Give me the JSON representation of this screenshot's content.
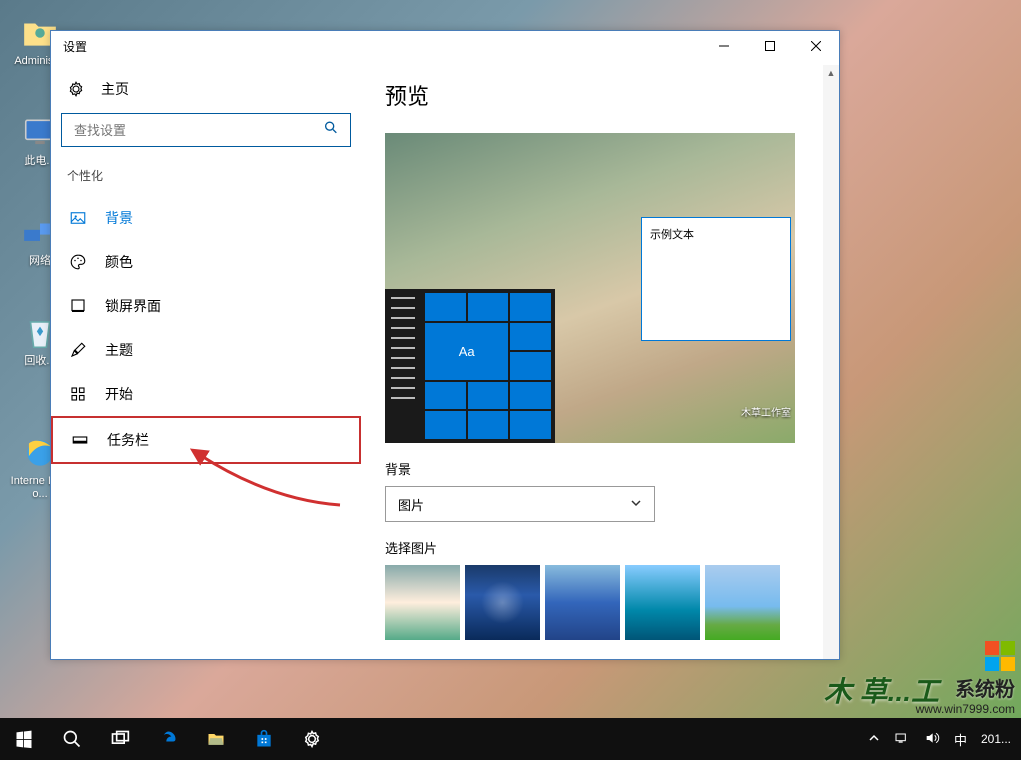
{
  "desktop": {
    "icons": [
      {
        "label": "Administ...",
        "glyph": "user"
      },
      {
        "label": "此电...",
        "glyph": "pc"
      },
      {
        "label": "网络",
        "glyph": "net"
      },
      {
        "label": "回收...",
        "glyph": "recycle"
      },
      {
        "label": "Interne Explo...",
        "glyph": "ie"
      }
    ]
  },
  "window": {
    "title": "设置",
    "home": "主页",
    "search_placeholder": "查找设置",
    "category": "个性化",
    "nav": [
      {
        "label": "背景",
        "icon": "picture"
      },
      {
        "label": "颜色",
        "icon": "palette"
      },
      {
        "label": "锁屏界面",
        "icon": "lock"
      },
      {
        "label": "主题",
        "icon": "brush"
      },
      {
        "label": "开始",
        "icon": "grid"
      },
      {
        "label": "任务栏",
        "icon": "taskbar"
      }
    ],
    "main": {
      "heading": "预览",
      "sample_text": "示例文本",
      "tile_text": "Aa",
      "bg_label": "背景",
      "bg_value": "图片",
      "choose_label": "选择图片"
    }
  },
  "taskbar": {
    "ime": "中",
    "clock": "201..."
  },
  "watermark": {
    "text": "系统粉",
    "url": "www.win7999.com"
  },
  "brand": "木 草...工"
}
